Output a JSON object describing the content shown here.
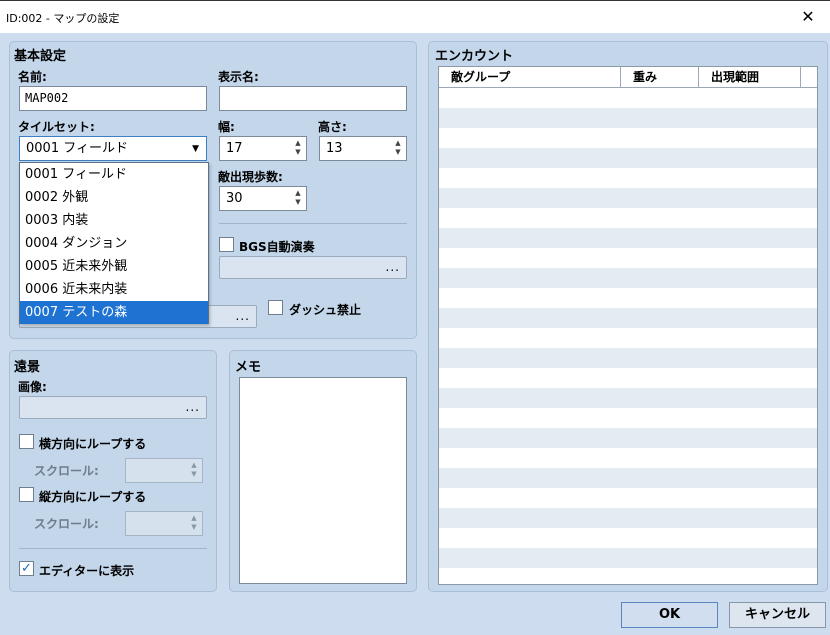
{
  "window": {
    "title": "ID:002 - マップの設定",
    "close": "✕"
  },
  "basic": {
    "title": "基本設定",
    "name_label": "名前:",
    "name_value": "MAP002",
    "display_label": "表示名:",
    "display_value": "",
    "tileset_label": "タイルセット:",
    "tileset_selected": "0001 フィールド",
    "width_label": "幅:",
    "width_value": "17",
    "height_label": "高さ:",
    "height_value": "13",
    "encounter_steps_label": "敵出現歩数:",
    "encounter_steps_value": "30",
    "bgs_label": "BGS自動演奏",
    "dash_label": "ダッシュ禁止",
    "tileset_options": [
      "0001 フィールド",
      "0002 外観",
      "0003 内装",
      "0004 ダンジョン",
      "0005 近未来外観",
      "0006 近未来内装",
      "0007 テストの森"
    ],
    "highlighted_option": "0007 テストの森"
  },
  "parallax": {
    "title": "遠景",
    "image_label": "画像:",
    "loop_h_label": "横方向にループする",
    "scroll_label_1": "スクロール:",
    "loop_v_label": "縦方向にループする",
    "scroll_label_2": "スクロール:",
    "show_editor_label": "エディターに表示",
    "show_editor_checked": true
  },
  "memo": {
    "title": "メモ"
  },
  "encounter": {
    "title": "エンカウント",
    "columns": [
      "敵グループ",
      "重み",
      "出現範囲"
    ]
  },
  "footer": {
    "ok": "OK",
    "cancel": "キャンセル"
  },
  "icons": {
    "ellipsis": "...",
    "check": "✓",
    "dropdown": "▼",
    "spin_up": "▲",
    "spin_down": "▼"
  },
  "colors": {
    "selection": "#1e73d2",
    "panel": "#c3d6ea",
    "background": "#cddcee"
  }
}
